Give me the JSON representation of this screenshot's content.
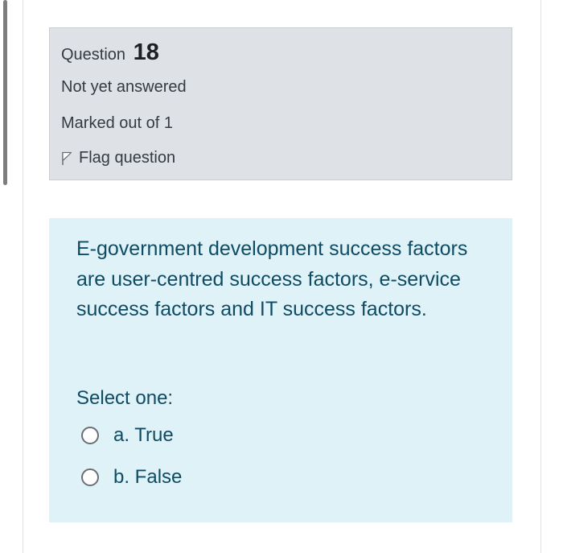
{
  "question": {
    "label": "Question",
    "number": "18",
    "state": "Not yet answered",
    "grade": "Marked out of 1",
    "flag_label": "Flag question",
    "flag_icon": "flag-icon"
  },
  "content": {
    "text": "E-government development success factors are user-centred success factors, e-service success factors and IT success factors.",
    "prompt": "Select one:",
    "options": [
      {
        "label": "a. True",
        "selected": false
      },
      {
        "label": "b. False",
        "selected": false
      }
    ]
  },
  "colors": {
    "info_bg": "#dee2e6",
    "content_bg": "#def2f8",
    "content_text": "#0f4c63"
  }
}
